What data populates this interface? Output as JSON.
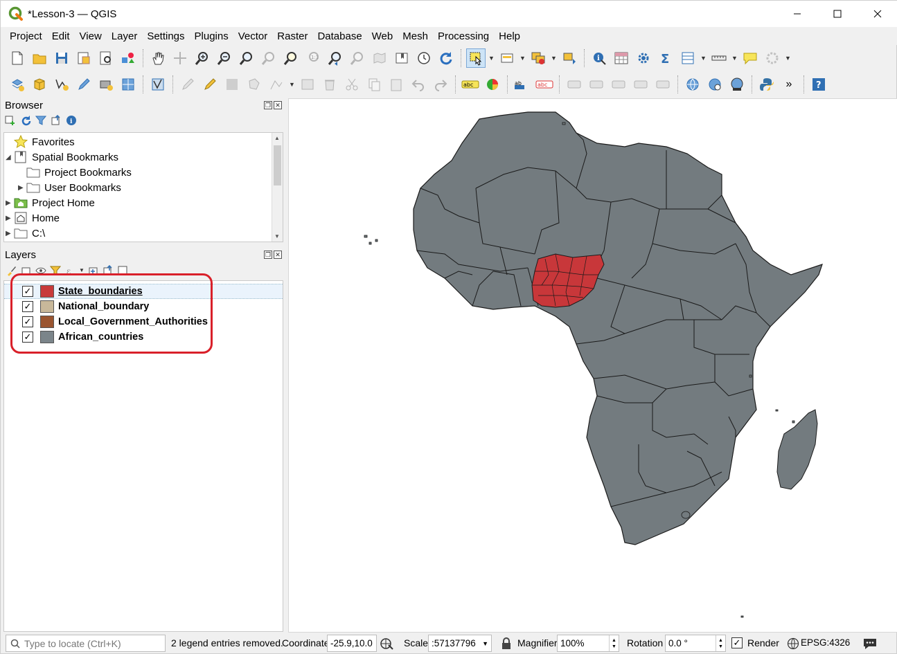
{
  "window": {
    "title": "*Lesson-3 — QGIS",
    "minimize_icon": "minimize-icon",
    "maximize_icon": "maximize-icon",
    "close_icon": "close-icon"
  },
  "menubar": {
    "items": [
      "Project",
      "Edit",
      "View",
      "Layer",
      "Settings",
      "Plugins",
      "Vector",
      "Raster",
      "Database",
      "Web",
      "Mesh",
      "Processing",
      "Help"
    ]
  },
  "browser": {
    "title": "Browser",
    "items": [
      {
        "label": "Favorites",
        "icon": "star-icon"
      },
      {
        "label": "Spatial Bookmarks",
        "icon": "bookmarks-icon",
        "expanded": true
      },
      {
        "label": "Project Bookmarks",
        "icon": "folder-icon"
      },
      {
        "label": "User Bookmarks",
        "icon": "folder-icon"
      },
      {
        "label": "Project Home",
        "icon": "project-home-icon"
      },
      {
        "label": "Home",
        "icon": "home-icon"
      },
      {
        "label": "C:\\",
        "icon": "folder-icon"
      }
    ]
  },
  "layers": {
    "title": "Layers",
    "items": [
      {
        "name": "State_boundaries",
        "checked": true,
        "color": "#c83a3a",
        "selected": true
      },
      {
        "name": "National_boundary",
        "checked": true,
        "color": "#c8b89a"
      },
      {
        "name": "Local_Government_Authorities",
        "checked": true,
        "color": "#9a5530"
      },
      {
        "name": "African_countries",
        "checked": true,
        "color": "#7b858a"
      }
    ]
  },
  "map": {
    "country_fill": "#737b7f",
    "highlight_fill": "#c8373a",
    "background": "#ffffff"
  },
  "statusbar": {
    "locator_placeholder": "Type to locate (Ctrl+K)",
    "message": "2 legend entries removed.",
    "coordinate_label": "Coordinate",
    "coordinate_value": "-25.9,10.0",
    "scale_label": "Scale",
    "scale_value": ":57137796",
    "magnifier_label": "Magnifier",
    "magnifier_value": "100%",
    "rotation_label": "Rotation",
    "rotation_value": "0.0 °",
    "render_label": "Render",
    "render_checked": true,
    "crs": "EPSG:4326"
  }
}
